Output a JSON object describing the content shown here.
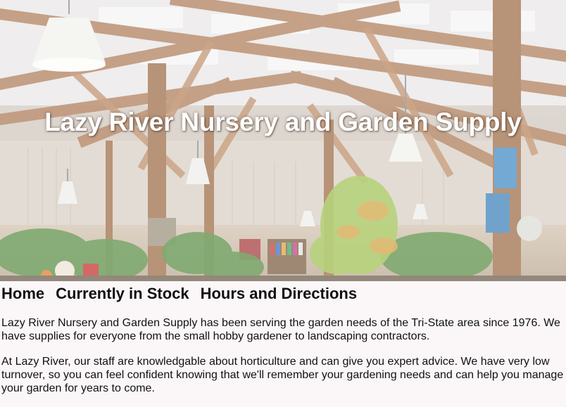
{
  "site": {
    "title": "Lazy River Nursery and Garden Supply"
  },
  "hero": {
    "image": "greenhouse-interior-photo"
  },
  "nav": {
    "items": [
      {
        "label": "Home"
      },
      {
        "label": "Currently in Stock"
      },
      {
        "label": "Hours and Directions"
      }
    ]
  },
  "content": {
    "paragraphs": [
      "Lazy River Nursery and Garden Supply has been serving the garden needs of the Tri-State area since 1976. We have supplies for everyone from the small hobby gardener to landscaping contractors.",
      "At Lazy River, our staff are knowledgable about horticulture and can give you expert advice. We have very low turnover, so you can feel confident knowing that we'll remember your gardening needs and can help you manage your garden for years to come."
    ]
  },
  "colors": {
    "page_background": "#fbf7f9",
    "title_text": "#ffffff",
    "nav_text": "#111111"
  }
}
